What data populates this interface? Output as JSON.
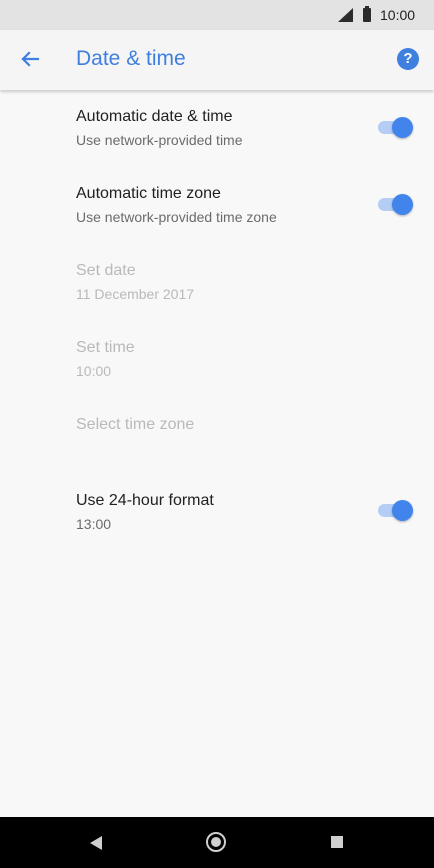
{
  "status_bar": {
    "time": "10:00",
    "signal_icon": "cell-signal-icon",
    "battery_icon": "battery-icon"
  },
  "app_bar": {
    "back_icon": "arrow-left-icon",
    "title": "Date & time",
    "help_icon": "help-circle-icon",
    "help_glyph": "?"
  },
  "settings": {
    "auto_date_time": {
      "label": "Automatic date & time",
      "summary": "Use network-provided time",
      "enabled": true
    },
    "auto_time_zone": {
      "label": "Automatic time zone",
      "summary": "Use network-provided time zone",
      "enabled": true
    },
    "set_date": {
      "label": "Set date",
      "summary": "11 December 2017",
      "disabled": true
    },
    "set_time": {
      "label": "Set time",
      "summary": "10:00",
      "disabled": true
    },
    "select_time_zone": {
      "label": "Select time zone",
      "disabled": true
    },
    "use_24_hour": {
      "label": "Use 24-hour format",
      "summary": "13:00",
      "enabled": true
    }
  },
  "nav_bar": {
    "back_icon": "nav-back-icon",
    "home_icon": "nav-home-icon",
    "recents_icon": "nav-recents-icon"
  },
  "colors": {
    "accent": "#3f7fe0",
    "toggle_thumb": "#4184ec",
    "toggle_track": "#b3cdf5",
    "disabled_text": "#b9b9b9"
  }
}
